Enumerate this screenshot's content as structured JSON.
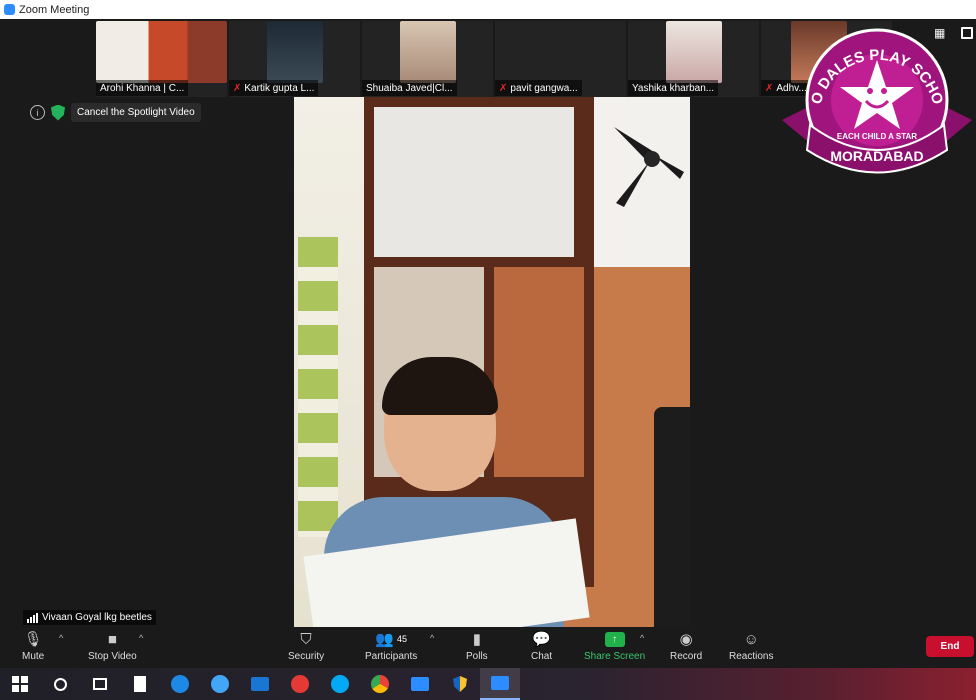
{
  "window": {
    "title": "Zoom Meeting"
  },
  "participants_strip": [
    {
      "name": "Arohi Khanna | C...",
      "muted": false
    },
    {
      "name": "Kartik gupta L...",
      "muted": true
    },
    {
      "name": "Shuaiba Javed|Cl...",
      "muted": false
    },
    {
      "name": "pavit gangwa...",
      "muted": true
    },
    {
      "name": "Yashika kharban...",
      "muted": false
    },
    {
      "name": "Adhv...",
      "muted": true
    }
  ],
  "spotlight": {
    "cancel_label": "Cancel the Spotlight Video"
  },
  "main_video": {
    "speaker_name": "Vivaan Goyal lkg beetles"
  },
  "logo": {
    "line1": "NEO DALES PLAY SCHOOL",
    "tagline": "EACH CHILD A STAR",
    "city": "MORADABAD"
  },
  "toolbar": {
    "mute": "Mute",
    "stop_video": "Stop Video",
    "security": "Security",
    "participants": "Participants",
    "participants_count": "45",
    "polls": "Polls",
    "chat": "Chat",
    "share_screen": "Share Screen",
    "record": "Record",
    "reactions": "Reactions",
    "end": "End"
  },
  "colors": {
    "share_green": "#22b24c",
    "end_red": "#c8102e",
    "logo_magenta": "#a0157d"
  },
  "taskbar_icons": [
    "windows-start-icon",
    "cortana-icon",
    "task-view-icon",
    "file-icon",
    "edge-legacy-icon",
    "internet-explorer-icon",
    "mail-icon",
    "opera-icon",
    "skype-icon",
    "chrome-icon",
    "zoom-icon",
    "security-shield-icon",
    "zoom-active-icon"
  ]
}
